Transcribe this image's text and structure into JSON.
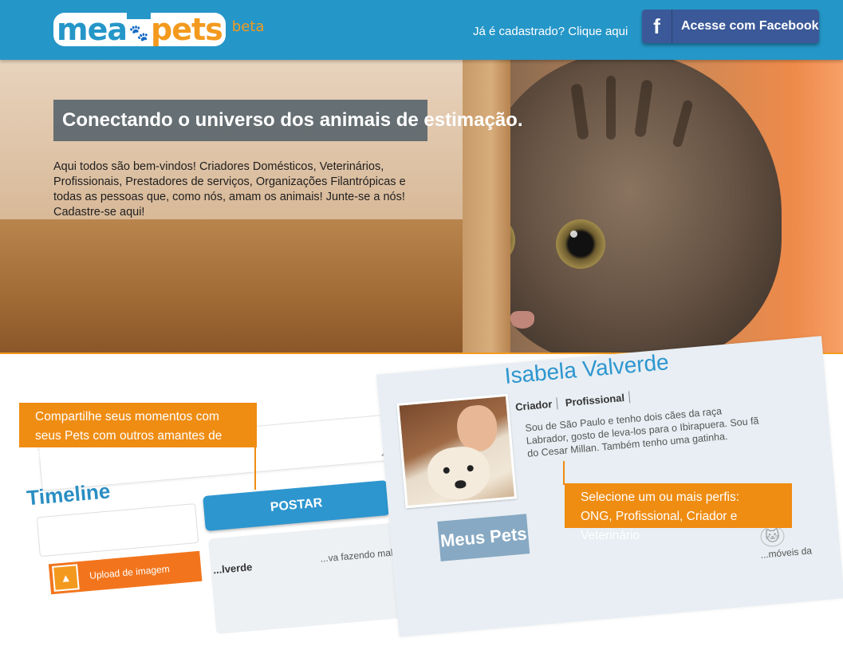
{
  "header": {
    "logo": {
      "mea": "mea",
      "pets": "pets",
      "beta": "beta"
    },
    "login_link": "Já é cadastrado? Clique aqui",
    "facebook_button": {
      "icon": "f",
      "label": "Acesse com Facebook"
    }
  },
  "hero": {
    "title": "Conectando o universo dos animais de estimação.",
    "text": "Aqui todos são bem-vindos! Criadores Domésticos, Veterinários, Profissionais, Prestadores de serviços, Organizações Filantrópicas e todas as pessoas que, como nós, amam os animais! Junte-se a nós! Cadastre-se aqui!"
  },
  "timeline": {
    "title": "Timeline",
    "post_button": "POSTAR",
    "upload_button": "Upload de imagem",
    "snippet_name": "...lverde",
    "snippet_text": "...va fazendo mal a"
  },
  "callouts": {
    "left": "Compartilhe seus momentos com seus Pets com outros amantes de animais",
    "right_line1": "Selecione um ou mais perfis:",
    "right_line2": "ONG, Profissional, Criador e Veterinário"
  },
  "profile": {
    "name": "Isabela Valverde",
    "roles": [
      "Criador",
      "Profissional"
    ],
    "bio": "Sou de São Paulo e tenho dois cães da raça Labrador, gosto de leva-los para o Ibirapuera. Sou fã do Cesar Millan. Também tenho uma gatinha.",
    "meus_pets": "Meus Pets",
    "snippet": "...móveis da"
  },
  "colors": {
    "header_blue": "#2596c8",
    "accent_orange": "#ef8c12",
    "facebook_blue": "#3b5998"
  }
}
